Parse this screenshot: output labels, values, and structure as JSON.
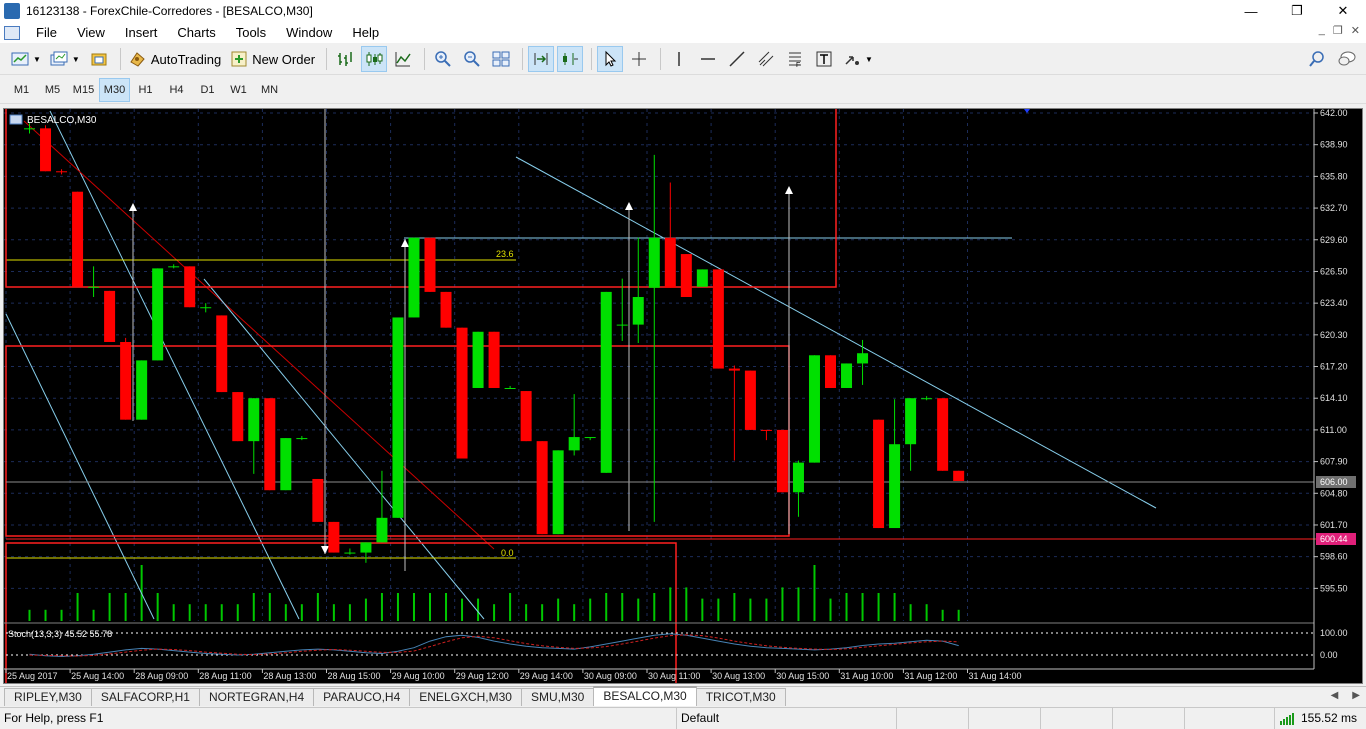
{
  "window": {
    "title": "16123138 - ForexChile-Corredores - [BESALCO,M30]",
    "controls": [
      "—",
      "❐",
      "✕"
    ]
  },
  "menu": {
    "items": [
      "File",
      "View",
      "Insert",
      "Charts",
      "Tools",
      "Window",
      "Help"
    ],
    "mdi_controls": [
      "_",
      "❐",
      "✕"
    ]
  },
  "toolbar": {
    "autotrading_label": "AutoTrading",
    "new_order_label": "New Order"
  },
  "timeframes": [
    "M1",
    "M5",
    "M15",
    "M30",
    "H1",
    "H4",
    "D1",
    "W1",
    "MN"
  ],
  "active_timeframe": "M30",
  "chart": {
    "title": "BESALCO,M30",
    "price_axis": [
      "642.00",
      "638.90",
      "635.80",
      "632.70",
      "629.60",
      "626.50",
      "623.40",
      "620.30",
      "617.20",
      "614.10",
      "611.00",
      "607.90",
      "604.80",
      "601.70",
      "598.60",
      "595.50"
    ],
    "current_price": "606.00",
    "level_price": "600.44",
    "fib_labels": [
      "23.6",
      "0.0"
    ],
    "time_axis": [
      "25 Aug 2017",
      "25 Aug 14:00",
      "28 Aug 09:00",
      "28 Aug 11:00",
      "28 Aug 13:00",
      "28 Aug 15:00",
      "29 Aug 10:00",
      "29 Aug 12:00",
      "29 Aug 14:00",
      "30 Aug 09:00",
      "30 Aug 11:00",
      "30 Aug 13:00",
      "30 Aug 15:00",
      "31 Aug 10:00",
      "31 Aug 12:00",
      "31 Aug 14:00"
    ],
    "stoch_label": "Stoch(13,3,3) 45.52 55.78",
    "stoch_axis": [
      "100.00",
      "0.00"
    ],
    "colors": {
      "background": "#000000",
      "bull": "#00e000",
      "bear": "#ff0000",
      "grid": "#1c2c5a",
      "volume": "#00c800",
      "trendline": "#87ceeb",
      "fib": "#e0e000"
    }
  },
  "chart_data": {
    "type": "candlestick",
    "ylim": [
      592.6,
      642.0
    ],
    "candles": [
      {
        "o": 640.5,
        "h": 641.0,
        "l": 640.0,
        "c": 640.5
      },
      {
        "o": 640.5,
        "h": 640.8,
        "l": 636.3,
        "c": 636.3
      },
      {
        "o": 636.3,
        "h": 636.5,
        "l": 636.0,
        "c": 636.2
      },
      {
        "o": 634.3,
        "h": 634.3,
        "l": 625.0,
        "c": 625.0
      },
      {
        "o": 625.0,
        "h": 627.0,
        "l": 624.0,
        "c": 625.0
      },
      {
        "o": 624.6,
        "h": 624.6,
        "l": 619.6,
        "c": 619.6
      },
      {
        "o": 619.6,
        "h": 620.0,
        "l": 612.0,
        "c": 612.0
      },
      {
        "o": 612.0,
        "h": 617.8,
        "l": 612.0,
        "c": 617.8
      },
      {
        "o": 617.8,
        "h": 626.8,
        "l": 617.8,
        "c": 626.8
      },
      {
        "o": 627.0,
        "h": 627.2,
        "l": 626.8,
        "c": 627.0
      },
      {
        "o": 627.0,
        "h": 627.0,
        "l": 623.0,
        "c": 623.0
      },
      {
        "o": 623.0,
        "h": 623.4,
        "l": 622.5,
        "c": 623.0
      },
      {
        "o": 622.2,
        "h": 622.2,
        "l": 614.7,
        "c": 614.7
      },
      {
        "o": 614.7,
        "h": 614.7,
        "l": 609.9,
        "c": 609.9
      },
      {
        "o": 609.9,
        "h": 614.1,
        "l": 606.7,
        "c": 614.1
      },
      {
        "o": 614.1,
        "h": 614.1,
        "l": 605.1,
        "c": 605.1
      },
      {
        "o": 605.1,
        "h": 610.2,
        "l": 605.1,
        "c": 610.2
      },
      {
        "o": 610.2,
        "h": 610.4,
        "l": 610.0,
        "c": 610.2
      },
      {
        "o": 606.2,
        "h": 606.2,
        "l": 602.0,
        "c": 602.0
      },
      {
        "o": 602.0,
        "h": 602.0,
        "l": 599.0,
        "c": 599.0
      },
      {
        "o": 599.0,
        "h": 599.4,
        "l": 598.8,
        "c": 599.0
      },
      {
        "o": 599.0,
        "h": 600.0,
        "l": 598.0,
        "c": 600.0
      },
      {
        "o": 600.0,
        "h": 607.0,
        "l": 600.0,
        "c": 602.4
      },
      {
        "o": 602.4,
        "h": 622.0,
        "l": 602.4,
        "c": 622.0
      },
      {
        "o": 622.0,
        "h": 629.8,
        "l": 622.0,
        "c": 629.8
      },
      {
        "o": 629.8,
        "h": 629.8,
        "l": 624.5,
        "c": 624.5
      },
      {
        "o": 624.5,
        "h": 624.5,
        "l": 621.0,
        "c": 621.0
      },
      {
        "o": 621.0,
        "h": 621.0,
        "l": 608.2,
        "c": 608.2
      },
      {
        "o": 615.1,
        "h": 620.6,
        "l": 615.1,
        "c": 620.6
      },
      {
        "o": 620.6,
        "h": 620.6,
        "l": 615.1,
        "c": 615.1
      },
      {
        "o": 615.1,
        "h": 615.3,
        "l": 615.0,
        "c": 615.1
      },
      {
        "o": 614.8,
        "h": 614.8,
        "l": 609.9,
        "c": 609.9
      },
      {
        "o": 609.9,
        "h": 609.9,
        "l": 600.8,
        "c": 600.8
      },
      {
        "o": 600.8,
        "h": 609.0,
        "l": 600.8,
        "c": 609.0
      },
      {
        "o": 609.0,
        "h": 614.5,
        "l": 608.5,
        "c": 610.3
      },
      {
        "o": 610.3,
        "h": 610.3,
        "l": 610.0,
        "c": 610.3
      },
      {
        "o": 606.8,
        "h": 624.5,
        "l": 606.8,
        "c": 624.5
      },
      {
        "o": 621.3,
        "h": 625.8,
        "l": 619.7,
        "c": 621.3
      },
      {
        "o": 621.3,
        "h": 629.8,
        "l": 619.5,
        "c": 624.0
      },
      {
        "o": 624.9,
        "h": 637.9,
        "l": 602.0,
        "c": 629.8
      },
      {
        "o": 629.8,
        "h": 635.2,
        "l": 624.9,
        "c": 624.9
      },
      {
        "o": 628.2,
        "h": 628.2,
        "l": 624.0,
        "c": 624.0
      },
      {
        "o": 625.0,
        "h": 626.7,
        "l": 625.0,
        "c": 626.7
      },
      {
        "o": 626.7,
        "h": 626.7,
        "l": 617.0,
        "c": 617.0
      },
      {
        "o": 617.0,
        "h": 617.3,
        "l": 608.0,
        "c": 616.8
      },
      {
        "o": 616.8,
        "h": 616.8,
        "l": 611.0,
        "c": 611.0
      },
      {
        "o": 611.0,
        "h": 611.0,
        "l": 610.0,
        "c": 610.9
      },
      {
        "o": 611.0,
        "h": 611.0,
        "l": 604.9,
        "c": 604.9
      },
      {
        "o": 604.9,
        "h": 608.0,
        "l": 602.5,
        "c": 607.8
      },
      {
        "o": 607.8,
        "h": 618.3,
        "l": 607.8,
        "c": 618.3
      },
      {
        "o": 618.3,
        "h": 618.3,
        "l": 615.1,
        "c": 615.1
      },
      {
        "o": 615.1,
        "h": 617.5,
        "l": 615.1,
        "c": 617.5
      },
      {
        "o": 617.5,
        "h": 619.8,
        "l": 615.4,
        "c": 618.5
      },
      {
        "o": 612.0,
        "h": 612.0,
        "l": 601.4,
        "c": 601.4
      },
      {
        "o": 601.4,
        "h": 614.0,
        "l": 601.4,
        "c": 609.6
      },
      {
        "o": 609.6,
        "h": 614.1,
        "l": 607.0,
        "c": 614.1
      },
      {
        "o": 614.1,
        "h": 614.3,
        "l": 613.9,
        "c": 614.1
      },
      {
        "o": 614.1,
        "h": 614.1,
        "l": 607.0,
        "c": 607.0
      },
      {
        "o": 607.0,
        "h": 607.0,
        "l": 606.0,
        "c": 606.0
      }
    ],
    "volumes": [
      2,
      2,
      2,
      5,
      2,
      5,
      5,
      10,
      5,
      3,
      3,
      3,
      3,
      3,
      5,
      5,
      3,
      3,
      5,
      3,
      3,
      4,
      5,
      5,
      5,
      5,
      5,
      4,
      4,
      3,
      5,
      3,
      3,
      4,
      3,
      4,
      5,
      5,
      4,
      5,
      6,
      6,
      4,
      4,
      5,
      4,
      4,
      6,
      6,
      10,
      4,
      5,
      5,
      5,
      5,
      3,
      3,
      2,
      2
    ],
    "stoch_k": [
      22,
      18,
      16,
      18,
      22,
      28,
      34,
      38,
      36,
      32,
      28,
      24,
      22,
      20,
      22,
      26,
      30,
      34,
      36,
      34,
      30,
      26,
      24,
      30,
      40,
      58,
      70,
      74,
      68,
      58,
      50,
      44,
      40,
      38,
      36,
      42,
      50,
      58,
      66,
      74,
      78,
      74,
      66,
      58,
      50,
      44,
      40,
      38,
      36,
      34,
      36,
      40,
      46,
      50,
      52,
      56,
      60,
      58,
      45.52
    ],
    "stoch_d": [
      20,
      19,
      18,
      17,
      19,
      23,
      28,
      33,
      36,
      35,
      32,
      28,
      25,
      22,
      21,
      23,
      26,
      30,
      33,
      35,
      33,
      30,
      27,
      27,
      31,
      43,
      56,
      67,
      71,
      67,
      59,
      51,
      45,
      41,
      38,
      39,
      43,
      50,
      58,
      66,
      73,
      75,
      73,
      66,
      58,
      51,
      45,
      41,
      38,
      36,
      35,
      37,
      41,
      45,
      49,
      53,
      56,
      58,
      55.78
    ]
  },
  "tabs": {
    "items": [
      "RIPLEY,M30",
      "SALFACORP,H1",
      "NORTEGRAN,H4",
      "PARAUCO,H4",
      "ENELGXCH,M30",
      "SMU,M30",
      "BESALCO,M30",
      "TRICOT,M30"
    ],
    "active": "BESALCO,M30"
  },
  "status": {
    "help": "For Help, press F1",
    "profile": "Default",
    "traffic": "155.52 ms"
  }
}
